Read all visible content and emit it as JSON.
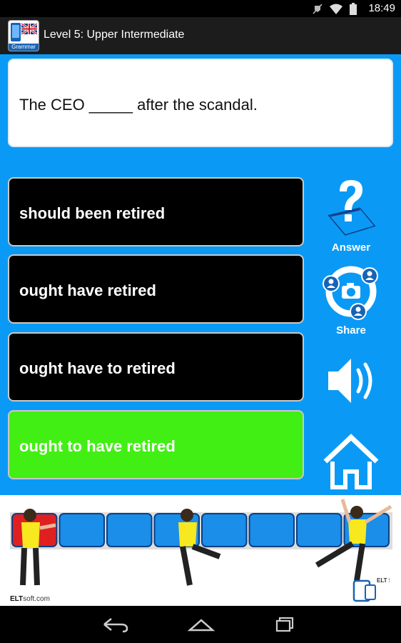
{
  "status_bar": {
    "time": "18:49"
  },
  "app_bar": {
    "icon_label": "Grammar",
    "title": "Level 5: Upper Intermediate"
  },
  "question": {
    "text": "The CEO _____ after the scandal."
  },
  "options": [
    {
      "label": "should been retired",
      "state": "default"
    },
    {
      "label": "ought have retired",
      "state": "default"
    },
    {
      "label": "ought have to retired",
      "state": "default"
    },
    {
      "label": "ought to have retired",
      "state": "correct"
    }
  ],
  "side_buttons": {
    "answer_label": "Answer",
    "share_label": "Share"
  },
  "ad": {
    "site_bold": "ELT",
    "site_rest": "soft.com",
    "brand_badge": "ELT SOFT"
  },
  "colors": {
    "background": "#0a9af5",
    "correct": "#42ef14",
    "option": "#000000",
    "progress_current": "#e02020",
    "progress_cell": "#1a8ee8"
  },
  "progress": {
    "total": 8,
    "current": 1
  }
}
